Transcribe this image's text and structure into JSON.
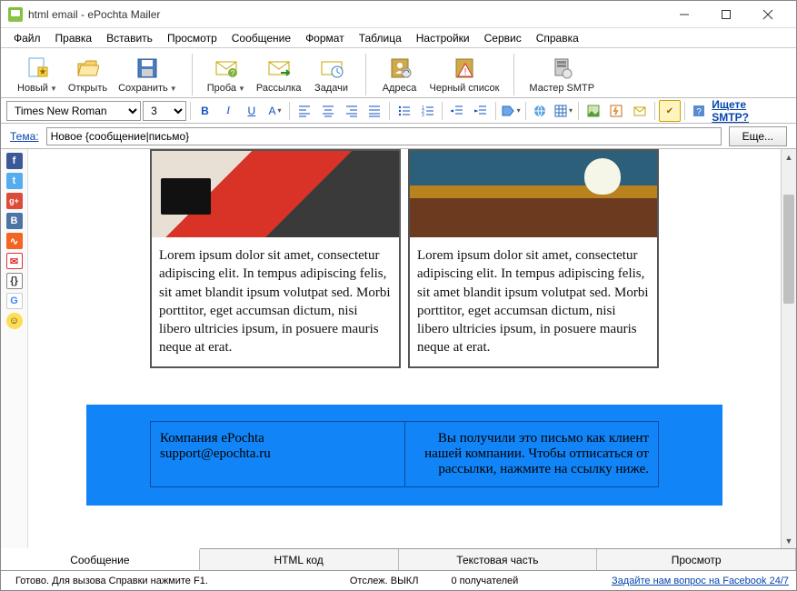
{
  "window": {
    "title": "html email - ePochta Mailer"
  },
  "menu": {
    "items": [
      "Файл",
      "Правка",
      "Вставить",
      "Просмотр",
      "Сообщение",
      "Формат",
      "Таблица",
      "Настройки",
      "Сервис",
      "Справка"
    ]
  },
  "ribbon": {
    "new": "Новый",
    "open": "Открыть",
    "save": "Сохранить",
    "test": "Проба",
    "send": "Рассылка",
    "tasks": "Задачи",
    "addr": "Адреса",
    "blacklist": "Черный список",
    "smtp": "Мастер SMTP"
  },
  "format": {
    "font": "Times New Roman",
    "size": "3",
    "smtp_link": "Ищете SMTP?"
  },
  "subject": {
    "label": "Тема:",
    "value": "Новое {сообщение|письмо}",
    "more": "Еще..."
  },
  "content": {
    "lorem": "Lorem ipsum dolor sit amet, consectetur adipiscing elit. In tempus adipiscing felis, sit amet blandit ipsum volutpat sed. Morbi porttitor, eget accumsan dictum, nisi libero ultricies ipsum, in posuere mauris neque at erat.",
    "footer_left_1": "Компания ePochta",
    "footer_left_2": "support@epochta.ru",
    "footer_right": "Вы получили это письмо как клиент нашей компании. Чтобы отписаться от рассылки, нажмите на ссылку ниже."
  },
  "bottom_tabs": {
    "msg": "Сообщение",
    "html": "HTML код",
    "text": "Текстовая часть",
    "preview": "Просмотр"
  },
  "status": {
    "ready": "Готово. Для вызова Справки нажмите F1.",
    "track": "Отслеж. ВЫКЛ",
    "recip": "0 получателей",
    "fb": "Задайте нам вопрос на Facebook 24/7"
  }
}
